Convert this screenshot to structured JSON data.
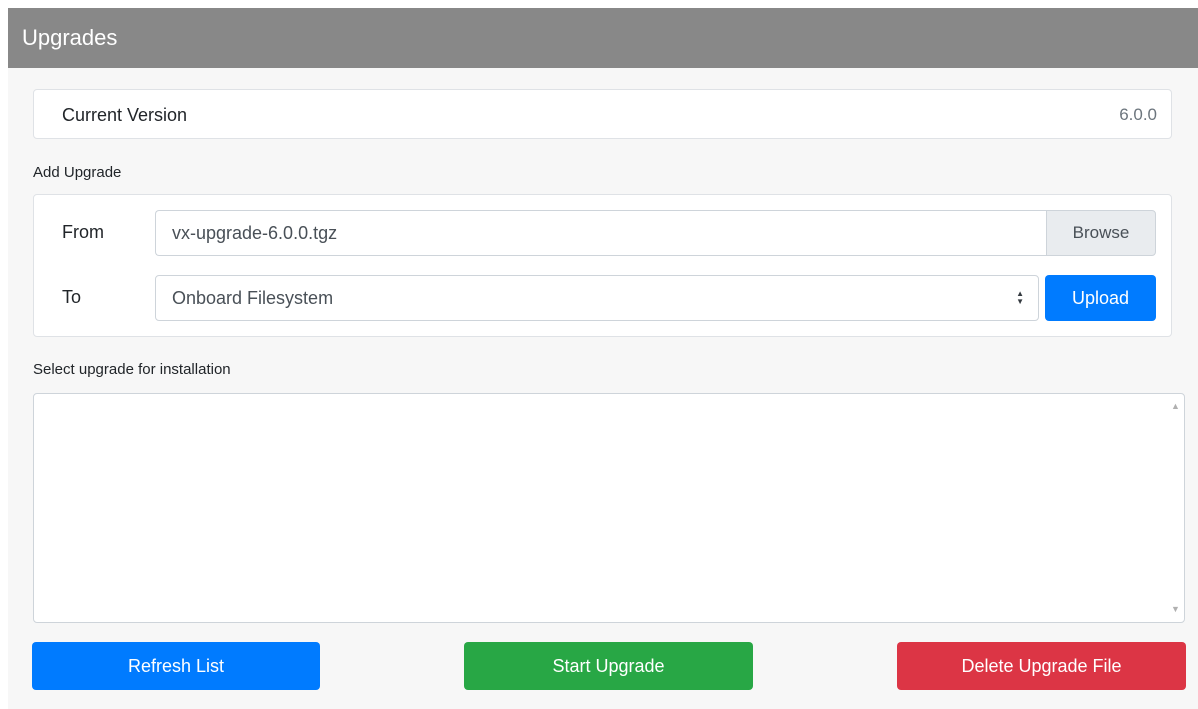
{
  "header": {
    "title": "Upgrades"
  },
  "current_version": {
    "label": "Current Version",
    "value": "6.0.0"
  },
  "add_upgrade": {
    "section_label": "Add Upgrade",
    "from_label": "From",
    "file_value": "vx-upgrade-6.0.0.tgz",
    "browse_label": "Browse",
    "to_label": "To",
    "destination_selected": "Onboard Filesystem",
    "upload_label": "Upload"
  },
  "install": {
    "section_label": "Select upgrade for installation",
    "items": []
  },
  "actions": {
    "refresh_label": "Refresh List",
    "start_label": "Start Upgrade",
    "delete_label": "Delete Upgrade File"
  },
  "colors": {
    "header_bg": "#888888",
    "primary": "#007bff",
    "success": "#28a745",
    "danger": "#dc3545"
  },
  "icons": {
    "select_arrow": "select-arrows-icon",
    "scroll_up": "scroll-up-arrow-icon",
    "scroll_down": "scroll-down-arrow-icon"
  }
}
